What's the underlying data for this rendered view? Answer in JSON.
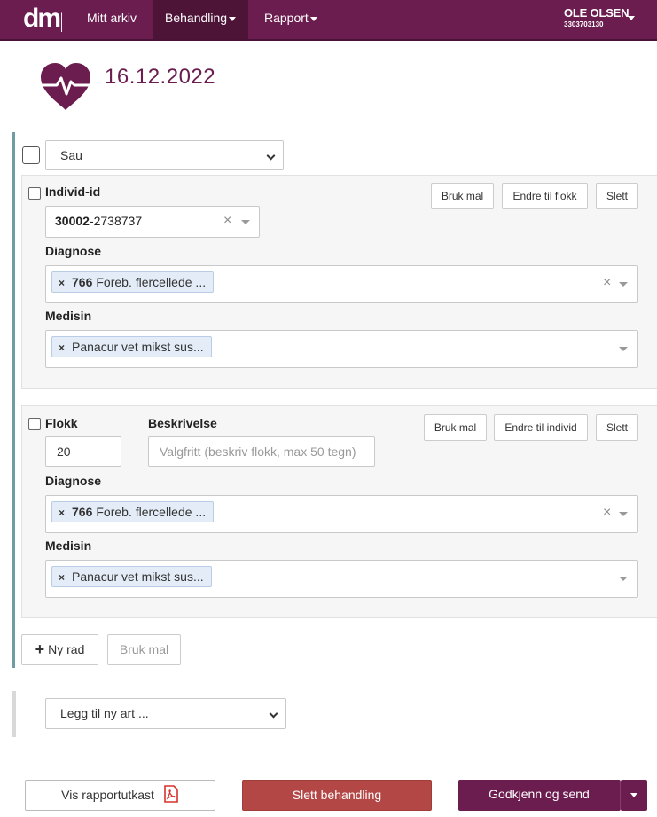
{
  "nav": {
    "items": [
      {
        "label": "Mitt arkiv",
        "has_caret": false
      },
      {
        "label": "Behandling",
        "has_caret": true,
        "active": true
      },
      {
        "label": "Rapport",
        "has_caret": true
      }
    ],
    "user": {
      "name": "OLE OLSEN",
      "id": "3303703130"
    },
    "colors": {
      "brand": "#6b1d4f",
      "active": "#4d1438"
    }
  },
  "header": {
    "date": "16.12.2022",
    "icon": "heart-pulse-icon"
  },
  "species_select": {
    "value": "Sau"
  },
  "individual_card": {
    "label": "Individ-id",
    "buttons": {
      "template": "Bruk mal",
      "convert": "Endre til flokk",
      "delete": "Slett"
    },
    "individual": {
      "code": "30002",
      "rest": "-2738737"
    },
    "diagnosis_label": "Diagnose",
    "diagnosis": {
      "code": "766",
      "text": "Foreb. flercellede ..."
    },
    "medicine_label": "Medisin",
    "medicine": {
      "text": "Panacur vet mikst sus..."
    }
  },
  "flock_card": {
    "label": "Flokk",
    "description_label": "Beskrivelse",
    "count": "20",
    "description_placeholder": "Valgfritt (beskriv flokk, max 50 tegn)",
    "buttons": {
      "template": "Bruk mal",
      "convert": "Endre til individ",
      "delete": "Slett"
    },
    "diagnosis_label": "Diagnose",
    "diagnosis": {
      "code": "766",
      "text": "Foreb. flercellede ..."
    },
    "medicine_label": "Medisin",
    "medicine": {
      "text": "Panacur vet mikst sus..."
    }
  },
  "row_actions": {
    "new_row": "Ny rad",
    "template": "Bruk mal"
  },
  "add_species": {
    "value": "Legg til ny art ..."
  },
  "footer": {
    "preview": "Vis rapportutkast",
    "delete": "Slett behandling",
    "approve": "Godkjenn og send",
    "colors": {
      "delete": "#b24745",
      "approve": "#6b1d4f"
    }
  }
}
